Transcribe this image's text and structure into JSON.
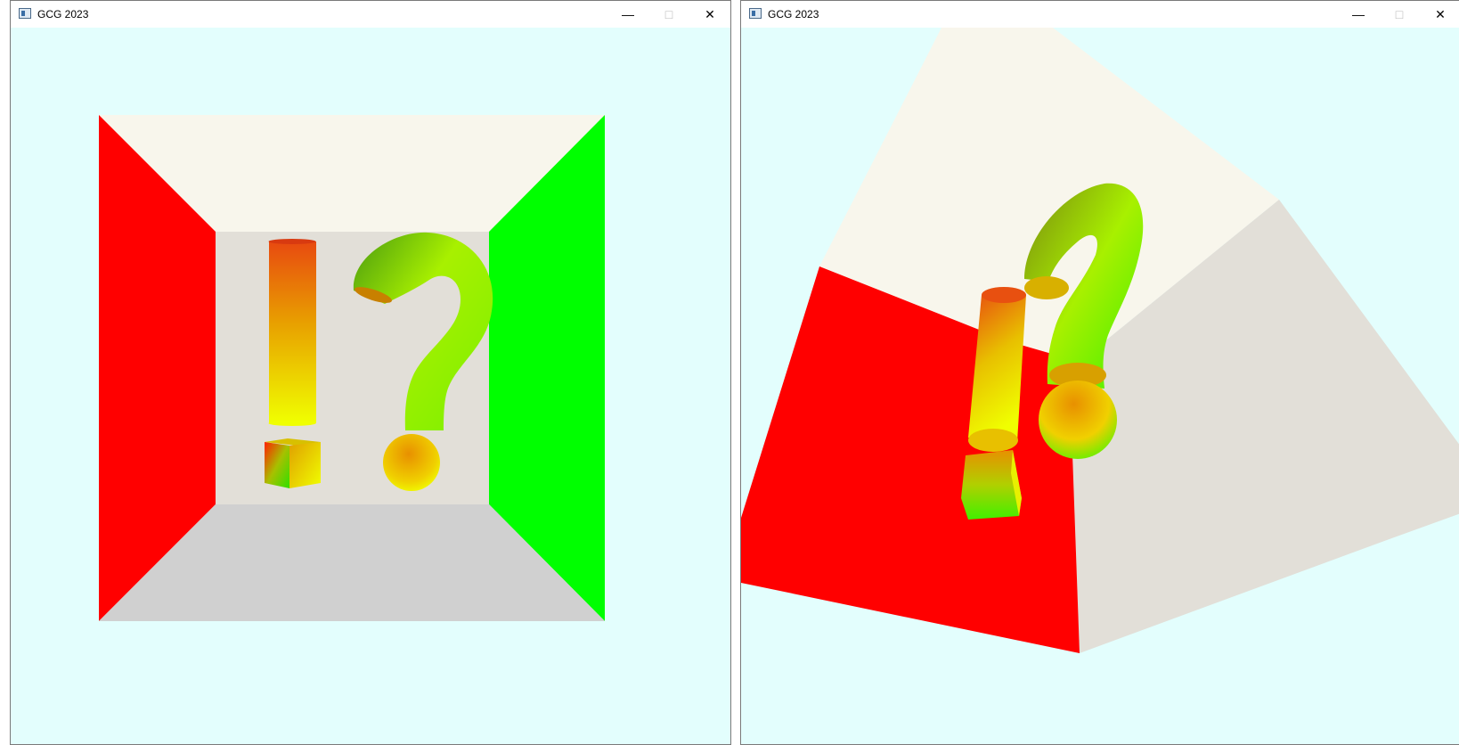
{
  "windows": [
    {
      "title": "GCG 2023",
      "controls": {
        "minimize": "—",
        "maximize": "□",
        "close": "✕"
      }
    },
    {
      "title": "GCG 2023",
      "controls": {
        "minimize": "—",
        "maximize": "□",
        "close": "✕"
      }
    }
  ],
  "colors": {
    "background": "#e3fefd",
    "left_wall": "#ff0000",
    "right_wall": "#00ff00",
    "ceiling": "#f8f6ec",
    "back_wall": "#e2dfd8",
    "floor": "#d0d0d0",
    "gradient_red": "#ff2a00",
    "gradient_orange": "#f07000",
    "gradient_yellow": "#e8f000",
    "gradient_green": "#44e000"
  },
  "icons": [
    "app-window-icon",
    "minimize-icon",
    "maximize-icon",
    "close-icon"
  ]
}
